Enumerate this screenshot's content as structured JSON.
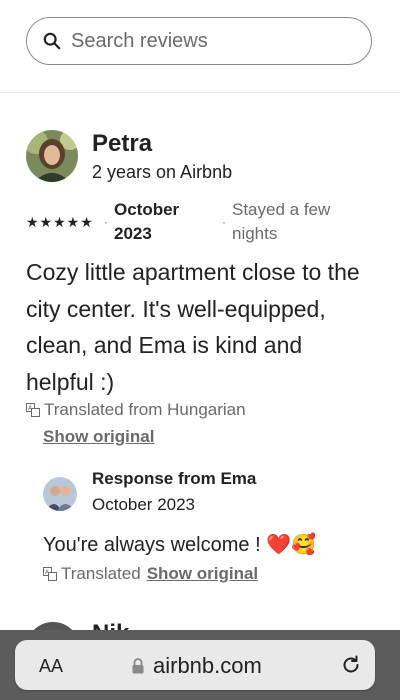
{
  "search": {
    "placeholder": "Search reviews"
  },
  "review": {
    "reviewer_name": "Petra",
    "reviewer_tenure": "2 years on Airbnb",
    "rating": 5,
    "stars_text": "★★★★★",
    "date": "October 2023",
    "stay": "Stayed a few nights",
    "text": "Cozy little apartment close to the city center. It's well-equipped, clean, and Ema is kind and helpful :)",
    "translated_label": "Translated from Hungarian",
    "show_original_label": "Show original"
  },
  "response": {
    "title": "Response from Ema",
    "date": "October 2023",
    "text": "You're always welcome ! ❤️🥰",
    "translated_label": "Translated",
    "show_original_label": "Show original"
  },
  "next_review": {
    "reviewer_name_partial": "Nik..."
  },
  "browser": {
    "text_size_label": "AA",
    "url": "airbnb.com"
  },
  "colors": {
    "text": "#222222",
    "muted": "#6a6a6a",
    "browser_bar": "#5c5c5c"
  }
}
